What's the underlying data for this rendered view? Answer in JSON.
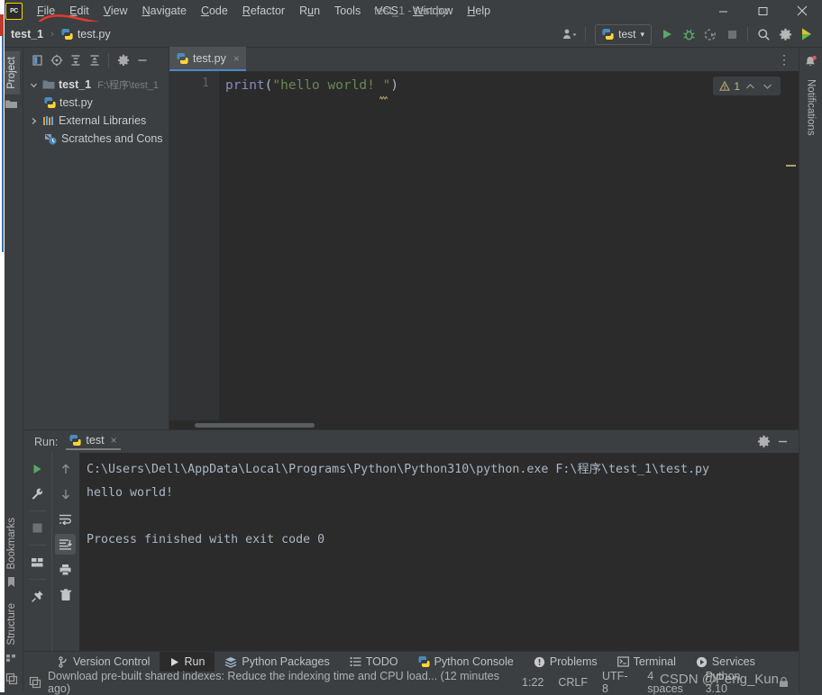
{
  "window": {
    "title": "test_1 - test.py",
    "logo_text": "PC",
    "minimize": "minimize-icon",
    "maximize": "maximize-icon",
    "close": "close-icon"
  },
  "menu": {
    "items": [
      {
        "label": "File",
        "mnemonic": "F"
      },
      {
        "label": "Edit",
        "mnemonic": "E"
      },
      {
        "label": "View",
        "mnemonic": "V"
      },
      {
        "label": "Navigate",
        "mnemonic": "N"
      },
      {
        "label": "Code",
        "mnemonic": "C"
      },
      {
        "label": "Refactor",
        "mnemonic": "R"
      },
      {
        "label": "Run",
        "mnemonic": "u"
      },
      {
        "label": "Tools",
        "mnemonic": ""
      },
      {
        "label": "VCS",
        "mnemonic": ""
      },
      {
        "label": "Window",
        "mnemonic": "W"
      },
      {
        "label": "Help",
        "mnemonic": "H"
      }
    ]
  },
  "navbar": {
    "breadcrumb_project": "test_1",
    "breadcrumb_sep": "›",
    "breadcrumb_file": "test.py",
    "run_config": "test",
    "run_config_caret": "▾",
    "icons": {
      "users": "user-avatar-icon",
      "run": "run-icon",
      "debug": "debug-icon",
      "coverage": "run-with-coverage-icon",
      "stop": "stop-icon",
      "search": "search-icon",
      "settings": "gear-icon",
      "updates": "plugin-update-icon"
    }
  },
  "left_sidebar": {
    "top": [
      {
        "label": "Project",
        "icon": "folder-icon",
        "selected": true
      }
    ],
    "bottom": [
      {
        "label": "Bookmarks",
        "icon": "bookmark-icon",
        "selected": false
      },
      {
        "label": "Structure",
        "icon": "structure-icon",
        "selected": false
      }
    ],
    "corner_icon": "layout-toggle-icon"
  },
  "right_sidebar": {
    "items": [
      {
        "label": "Notifications",
        "icon": "bell-icon",
        "badge": true
      }
    ]
  },
  "project_panel": {
    "toolbar": [
      {
        "name": "select-opened-file-icon"
      },
      {
        "name": "locate-target-icon"
      },
      {
        "name": "expand-all-icon"
      },
      {
        "name": "collapse-all-icon"
      },
      {
        "name": "gear-icon"
      },
      {
        "name": "hide-panel-icon"
      }
    ],
    "tree": [
      {
        "arrow": "⌄",
        "label": "test_1",
        "path": "F:\\程序\\test_1",
        "icon": "folder-icon",
        "bold": true,
        "indent": 0
      },
      {
        "arrow": "",
        "label": "test.py",
        "path": "",
        "icon": "python-file-icon",
        "bold": false,
        "indent": 1
      },
      {
        "arrow": "›",
        "label": "External Libraries",
        "path": "",
        "icon": "libraries-icon",
        "bold": false,
        "indent": 0
      },
      {
        "arrow": "",
        "label": "Scratches and Cons",
        "path": "",
        "icon": "scratches-icon",
        "bold": false,
        "indent": 0
      }
    ]
  },
  "editor": {
    "tab": {
      "label": "test.py",
      "icon": "python-file-icon",
      "close": "×"
    },
    "options_icon": "more-options-icon",
    "line_numbers": [
      "1"
    ],
    "code_tokens": [
      {
        "text": "print",
        "type": "function"
      },
      {
        "text": "(",
        "type": "paren"
      },
      {
        "text": "\"hello world! \"",
        "type": "string"
      },
      {
        "text": ")",
        "type": "paren"
      }
    ],
    "code_plain": "print(\"hello world! \")",
    "inspection": {
      "icon": "warning-icon",
      "count": "1",
      "prev": "⌃",
      "next": "⌄"
    }
  },
  "run_panel": {
    "label": "Run:",
    "tab": {
      "label": "test",
      "icon": "python-icon",
      "close": "×"
    },
    "header_icons": [
      {
        "name": "gear-icon"
      },
      {
        "name": "hide-panel-icon"
      }
    ],
    "left_gutter_icons": [
      {
        "name": "rerun-icon"
      },
      {
        "name": "edit-configuration-icon"
      },
      {
        "name": "stop-icon"
      },
      {
        "name": "layout-icon"
      },
      {
        "name": "pin-tab-icon"
      }
    ],
    "right_gutter_icons": [
      {
        "name": "up-arrow-icon"
      },
      {
        "name": "down-arrow-icon"
      },
      {
        "name": "soft-wrap-icon"
      },
      {
        "name": "scroll-to-end-icon",
        "selected": true
      },
      {
        "name": "print-icon"
      },
      {
        "name": "clear-all-icon"
      }
    ],
    "console_lines": [
      "C:\\Users\\Dell\\AppData\\Local\\Programs\\Python\\Python310\\python.exe F:\\程序\\test_1\\test.py",
      "hello world!",
      "",
      "Process finished with exit code 0"
    ]
  },
  "bottom_tabs": [
    {
      "label": "Version Control",
      "icon": "branch-icon",
      "selected": false
    },
    {
      "label": "Run",
      "icon": "run-icon",
      "selected": true
    },
    {
      "label": "Python Packages",
      "icon": "packages-icon",
      "selected": false
    },
    {
      "label": "TODO",
      "icon": "todo-icon",
      "selected": false
    },
    {
      "label": "Python Console",
      "icon": "python-icon",
      "selected": false
    },
    {
      "label": "Problems",
      "icon": "problems-icon",
      "selected": false
    },
    {
      "label": "Terminal",
      "icon": "terminal-icon",
      "selected": false
    },
    {
      "label": "Services",
      "icon": "services-icon",
      "selected": false
    }
  ],
  "status_bar": {
    "icon": "event-log-icon",
    "message": "Download pre-built shared indexes: Reduce the indexing time and CPU load... (12 minutes ago)",
    "caret": "1:22",
    "line_sep": "CRLF",
    "encoding": "UTF-8",
    "indent": "4 spaces",
    "interpreter": "Python 3.10",
    "lock_icon": "lock-icon"
  },
  "watermark": "CSDN @Peng_Kun",
  "colors": {
    "bg": "#3c3f41",
    "editor_bg": "#2b2b2b",
    "accent_tab": "#4a88c7",
    "run_green": "#59a869",
    "string_green": "#6a8759",
    "fn_purple": "#8888c6",
    "warning_yellow": "#bbbb88"
  }
}
